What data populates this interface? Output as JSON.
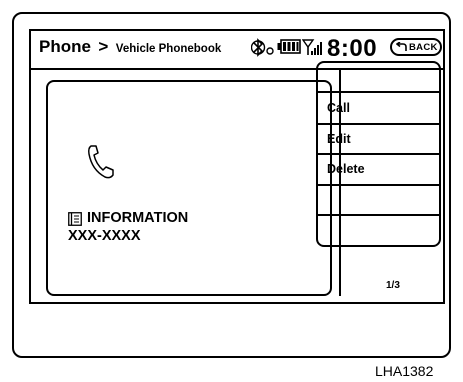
{
  "header": {
    "title": "Phone",
    "separator": ">",
    "subtitle": "Vehicle Phonebook",
    "clock": "8:00",
    "back_label": "BACK"
  },
  "status_icons": [
    "bluetooth-icon",
    "battery-icon",
    "signal-icon"
  ],
  "contact": {
    "icon": "phone-handset-icon",
    "type_icon": "phonebook-icon",
    "name": "INFORMATION",
    "number": "XXX-XXXX"
  },
  "menu": {
    "items": [
      {
        "label": ""
      },
      {
        "label": "Call"
      },
      {
        "label": "Edit"
      },
      {
        "label": "Delete"
      },
      {
        "label": ""
      },
      {
        "label": ""
      }
    ],
    "page_indicator": "1/3"
  },
  "figure_caption": "LHA1382"
}
